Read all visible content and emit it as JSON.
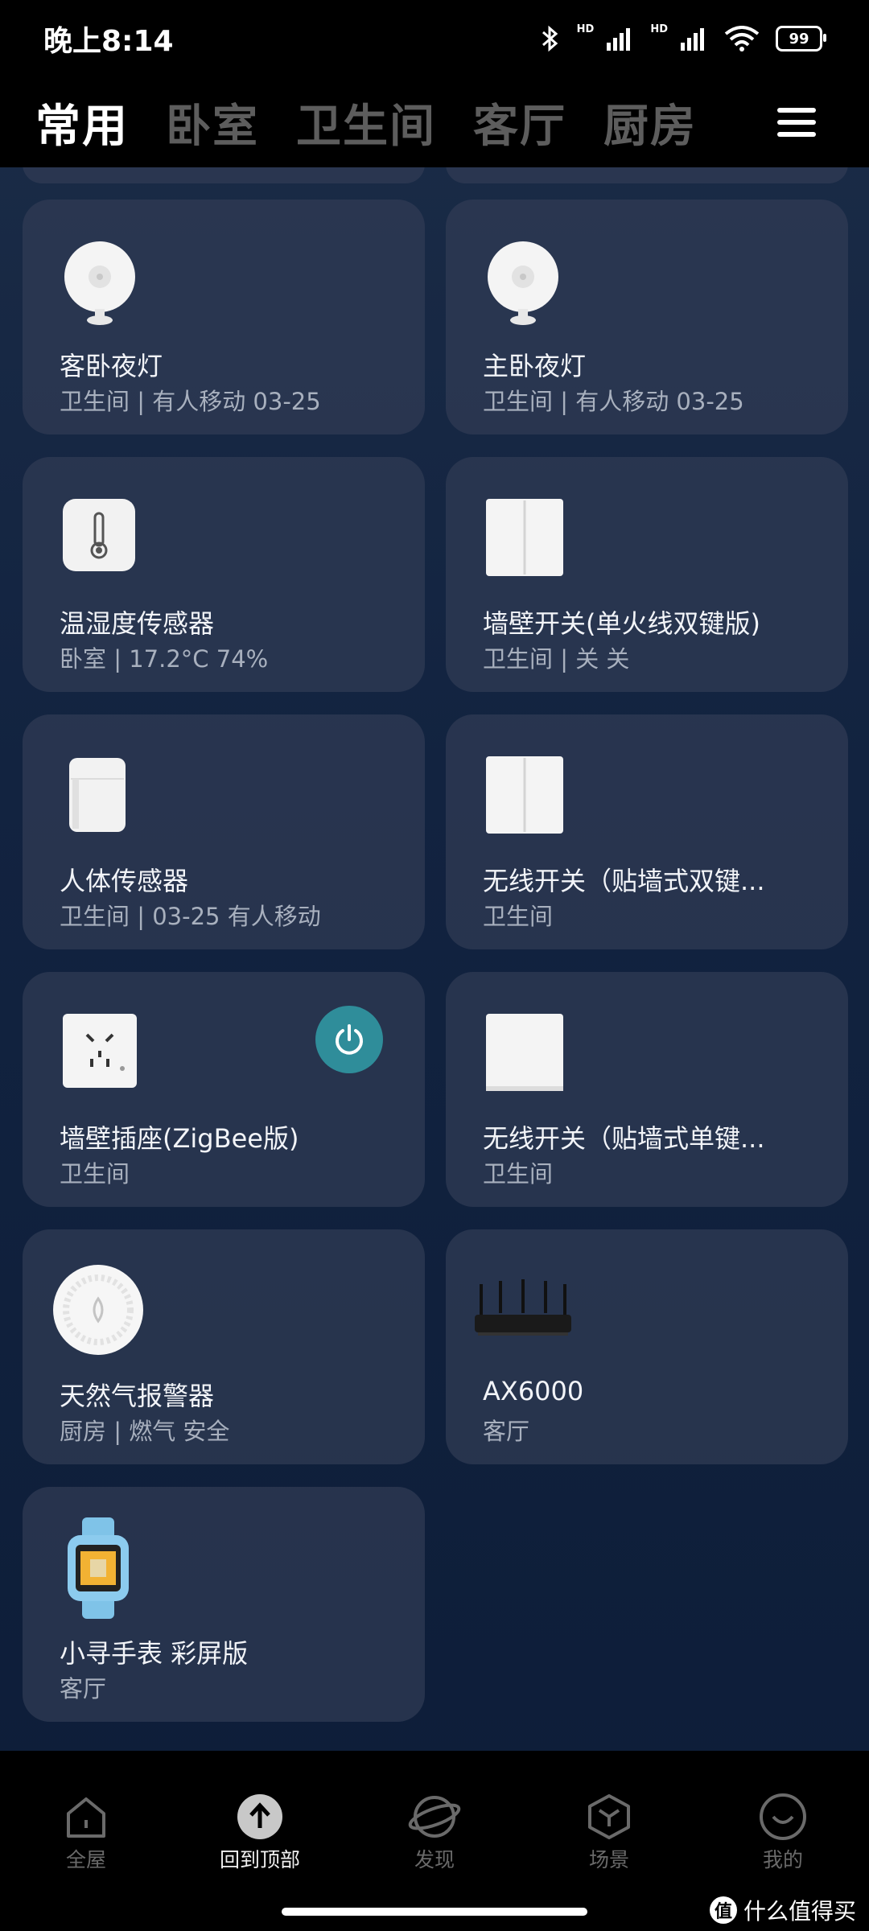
{
  "status": {
    "time": "晚上8:14",
    "hd1": "HD",
    "hd2": "HD",
    "battery": "99"
  },
  "tabs": [
    "常用",
    "卧室",
    "卫生间",
    "客厅",
    "厨房"
  ],
  "devices": [
    {
      "name": "客卧夜灯",
      "sub": "卫生间 | 有人移动 03-25",
      "icon": "night-light-icon"
    },
    {
      "name": "主卧夜灯",
      "sub": "卫生间 | 有人移动 03-25",
      "icon": "night-light-icon"
    },
    {
      "name": "温湿度传感器",
      "sub": "卧室 | 17.2°C 74%",
      "icon": "thermometer-icon"
    },
    {
      "name": "墙壁开关(单火线双键版)",
      "sub": "卫生间 | 关 关",
      "icon": "double-switch-icon"
    },
    {
      "name": "人体传感器",
      "sub": "卫生间 | 03-25 有人移动",
      "icon": "motion-sensor-icon"
    },
    {
      "name": "无线开关（贴墙式双键...",
      "sub": "卫生间",
      "icon": "double-switch-icon"
    },
    {
      "name": "墙壁插座(ZigBee版)",
      "sub": "卫生间",
      "icon": "socket-icon"
    },
    {
      "name": "无线开关（贴墙式单键...",
      "sub": "卫生间",
      "icon": "single-switch-icon"
    },
    {
      "name": "天然气报警器",
      "sub": "厨房 | 燃气 安全",
      "icon": "gas-alarm-icon"
    },
    {
      "name": "AX6000",
      "sub": "客厅",
      "icon": "router-icon"
    },
    {
      "name": "小寻手表 彩屏版",
      "sub": "客厅",
      "icon": "watch-icon"
    }
  ],
  "nav": [
    {
      "label": "全屋",
      "icon": "home-icon"
    },
    {
      "label": "回到顶部",
      "icon": "back-to-top-icon"
    },
    {
      "label": "发现",
      "icon": "planet-icon"
    },
    {
      "label": "场景",
      "icon": "scene-cube-icon"
    },
    {
      "label": "我的",
      "icon": "smile-icon"
    }
  ],
  "watermark": {
    "logo": "值",
    "text": "什么值得买"
  },
  "colors": {
    "power_button": "#2f8d9a",
    "card": "#303c54"
  }
}
